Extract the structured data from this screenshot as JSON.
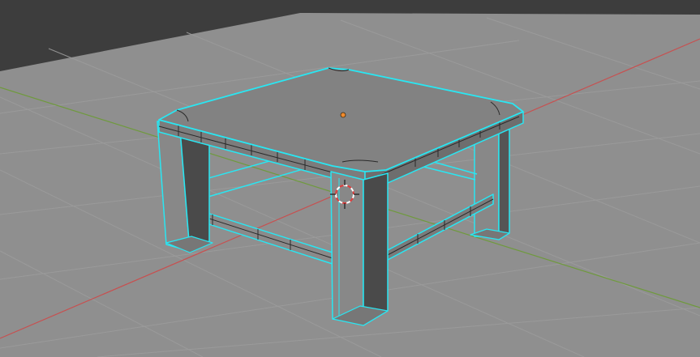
{
  "viewport": {
    "mode": "edit-mode",
    "view": "perspective"
  },
  "colors": {
    "background_far": "#3d3d3d",
    "ground": "#8f8f8f",
    "grid_line": "#9c9c9c",
    "x_axis": "#c75050",
    "y_axis": "#6f9a3d",
    "face_light": "#888888",
    "face_top": "#7f7f7f",
    "face_side": "#555555",
    "face_dark": "#4a4a4a",
    "edge_selected": "#29e6f2",
    "edge_dark": "#2a2a2a",
    "origin": "#f08a2c",
    "cursor_red": "#e23b3b",
    "cursor_white": "#ffffff"
  },
  "objects": [
    {
      "name": "table",
      "selected": true
    }
  ],
  "icons": {
    "origin": "object-origin-dot",
    "cursor": "3d-cursor"
  }
}
